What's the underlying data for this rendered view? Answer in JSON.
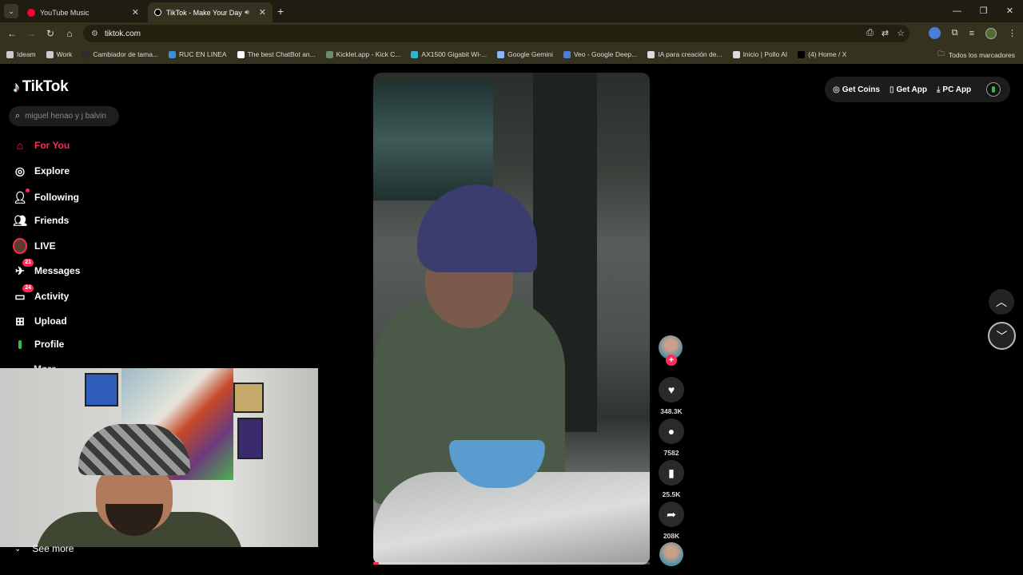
{
  "browser": {
    "tabs": [
      {
        "title": "YouTube Music",
        "favicon_color": "#ff0033"
      },
      {
        "title": "TikTok - Make Your Day",
        "favicon_color": "#000000",
        "active": true
      }
    ],
    "url": "tiktok.com",
    "bookmarks": [
      {
        "label": "Ideam",
        "color": "#cccccc"
      },
      {
        "label": "Work",
        "color": "#cccccc"
      },
      {
        "label": "Cambiador de tama...",
        "color": "#2c2c2c"
      },
      {
        "label": "RUC EN LINEA",
        "color": "#3a8fd6"
      },
      {
        "label": "The best ChatBot an...",
        "color": "#ffffff"
      },
      {
        "label": "Kicklet.app - Kick C...",
        "color": "#6c8a6c"
      },
      {
        "label": "AX1500 Gigabit Wi-...",
        "color": "#36b3c9"
      },
      {
        "label": "Google Gemini",
        "color": "#8ab4f8"
      },
      {
        "label": "Veo - Google Deep...",
        "color": "#4a7fd6"
      },
      {
        "label": "IA para creación de...",
        "color": "#dddddd"
      },
      {
        "label": "Inicio | Pollo AI",
        "color": "#dddddd"
      },
      {
        "label": "(4) Home / X",
        "color": "#000000"
      }
    ],
    "all_bookmarks_label": "Todos los marcadores"
  },
  "tiktok": {
    "logo_text": "TikTok",
    "search_placeholder": "miguel henao y j balvin",
    "nav": [
      {
        "label": "For You",
        "icon": "home-icon",
        "active": true
      },
      {
        "label": "Explore",
        "icon": "compass-icon"
      },
      {
        "label": "Following",
        "icon": "following-icon"
      },
      {
        "label": "Friends",
        "icon": "friends-icon"
      },
      {
        "label": "LIVE",
        "icon": "live-icon"
      },
      {
        "label": "Messages",
        "icon": "messages-icon",
        "badge": "21"
      },
      {
        "label": "Activity",
        "icon": "activity-icon",
        "badge": "24"
      },
      {
        "label": "Upload",
        "icon": "upload-icon"
      },
      {
        "label": "Profile",
        "icon": "profile-icon"
      }
    ],
    "more_label": "More",
    "see_more_label": "See more",
    "top_actions": {
      "coins": "Get Coins",
      "app": "Get App",
      "pc_app": "PC App"
    },
    "video_actions": {
      "likes": "348.3K",
      "comments": "7582",
      "saves": "25.5K",
      "shares": "208K"
    },
    "accent_color": "#fe2c55",
    "video_progress": 0.02
  }
}
